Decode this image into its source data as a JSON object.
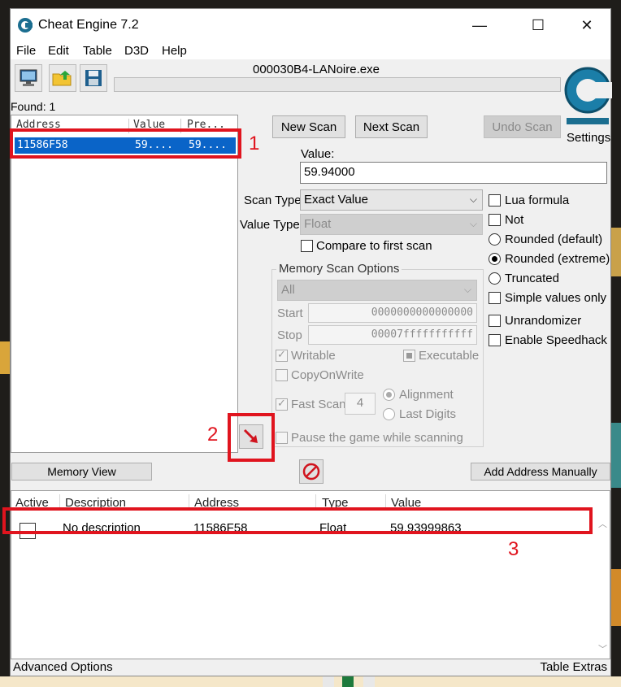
{
  "window": {
    "title": "Cheat Engine 7.2",
    "minimize": "—",
    "maximize": "☐",
    "close": "✕"
  },
  "menu": [
    "File",
    "Edit",
    "Table",
    "D3D",
    "Help"
  ],
  "process_title": "000030B4-LANoire.exe",
  "settings_label": "Settings",
  "found_label": "Found: 1",
  "address_list": {
    "columns": [
      "Address",
      "Value",
      "Pre..."
    ],
    "rows": [
      {
        "address": "11586F58",
        "value": "59....",
        "previous": "59...."
      }
    ]
  },
  "buttons": {
    "new_scan": "New Scan",
    "next_scan": "Next Scan",
    "undo_scan": "Undo Scan",
    "memory_view": "Memory View",
    "add_address_manually": "Add Address Manually"
  },
  "value_label": "Value:",
  "value_input": "59.94000",
  "scan_type": {
    "label": "Scan Type",
    "selected": "Exact Value"
  },
  "value_type": {
    "label": "Value Type",
    "selected": "Float"
  },
  "compare_first_scan": "Compare to first scan",
  "right_options": {
    "lua_formula": "Lua formula",
    "not": "Not",
    "rounded_default": "Rounded (default)",
    "rounded_extreme": "Rounded (extreme)",
    "truncated": "Truncated",
    "simple_values_only": "Simple values only",
    "unrandomizer": "Unrandomizer",
    "enable_speedhack": "Enable Speedhack"
  },
  "memory_scan_options": {
    "title": "Memory Scan Options",
    "region": "All",
    "start_label": "Start",
    "start_value": "0000000000000000",
    "stop_label": "Stop",
    "stop_value": "00007fffffffffff",
    "writable": "Writable",
    "executable": "Executable",
    "copy_on_write": "CopyOnWrite",
    "fast_scan": "Fast Scan",
    "fast_scan_value": "4",
    "alignment": "Alignment",
    "last_digits": "Last Digits",
    "pause_game": "Pause the game while scanning"
  },
  "cheat_table": {
    "columns": [
      "Active",
      "Description",
      "Address",
      "Type",
      "Value"
    ],
    "rows": [
      {
        "description": "No description",
        "address": "11586F58",
        "type": "Float",
        "value": "59.93999863"
      }
    ]
  },
  "status": {
    "left": "Advanced Options",
    "right": "Table Extras"
  },
  "annotations": [
    "1",
    "2",
    "3"
  ],
  "colors": {
    "annotation": "#e0141e",
    "selection": "#0a64c8"
  }
}
